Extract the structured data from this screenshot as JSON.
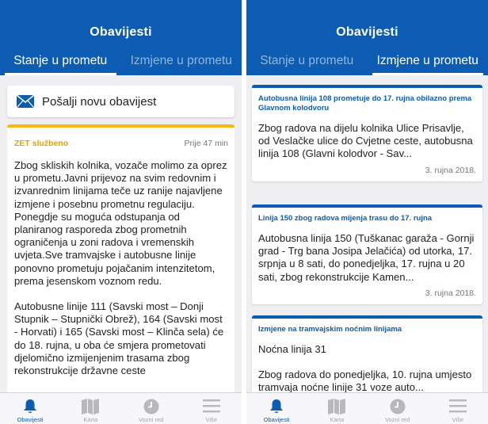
{
  "colors": {
    "brand": "#0b5cb2",
    "accent_yellow": "#f5b90b",
    "inactive_icon": "#b8b8bd"
  },
  "left": {
    "header": {
      "title": "Obavijesti"
    },
    "tabs": [
      {
        "label": "Stanje u prometu",
        "active": true
      },
      {
        "label": "Izmjene u prometu",
        "active": false
      }
    ],
    "send_button": {
      "label": "Pošalji novu obavijest",
      "icon": "envelope-icon"
    },
    "notice": {
      "source": "ZET službeno",
      "age": "Prije 47 min",
      "paragraphs": [
        "Zbog skliskih kolnika, vozače molimo za oprez u prometu.Javni prijevoz na svim redovnim i izvanrednim linijama teče uz ranije najavljene izmjene i posebnu prometnu regulaciju. Ponegdje su moguća odstupanja od planiranog rasporeda zbog prometnih ograničenja u zoni radova i vremenskih uvjeta.Sve tramvajske i autobusne linije ponovno prometuju pojačanim intenzitetom, prema jesenskom voznom redu.",
        "Autobusne linije 111 (Savski most – Donji Stupnik – Stupnički Obrež), 164 (Savski most - Horvati) i 165 (Savski most – Klinča sela) će do 18. rujna, u oba će smjera prometovati djelomično izmijenjenim trasama zbog rekonstrukcije državne ceste"
      ]
    }
  },
  "right": {
    "header": {
      "title": "Obavijesti"
    },
    "tabs": [
      {
        "label": "Stanje u prometu",
        "active": false
      },
      {
        "label": "Izmjene u prometu",
        "active": true
      }
    ],
    "cards": [
      {
        "title": "Autobusna linija 108 prometuje do 17. rujna obilazno prema Glavnom kolodvoru",
        "body": "Zbog radova na dijelu kolnika Ulice Prisavlje, od Veslačke ulice do Cvjetne ceste, autobusna linija 108 (Glavni kolodvor - Sav...",
        "date": "3. rujna 2018."
      },
      {
        "title": "Linija 150 zbog radova mijenja trasu do 17. rujna",
        "body": "Autobusna linija 150 (Tuškanac garaža - Gornji grad - Trg bana Josipa Jelačića) od utorka, 17. srpnja u 8 sati, do ponedjeljka, 17. rujna u 20 sati, zbog rekonstrukcije Kamen...",
        "date": "3. rujna 2018."
      },
      {
        "title": "Izmjene na tramvajskim noćnim linijama",
        "subtitle": "Noćna linija 31",
        "body": "Zbog radova do ponedjeljka, 10. rujna umjesto tramvaja noćne linije 31 voze auto..."
      }
    ]
  },
  "tabbar": [
    {
      "label": "Obavijesti",
      "icon": "bell-icon",
      "active": true
    },
    {
      "label": "Karta",
      "icon": "map-icon",
      "active": false
    },
    {
      "label": "Vozni red",
      "icon": "clock-icon",
      "active": false
    },
    {
      "label": "Više",
      "icon": "menu-icon",
      "active": false
    }
  ]
}
